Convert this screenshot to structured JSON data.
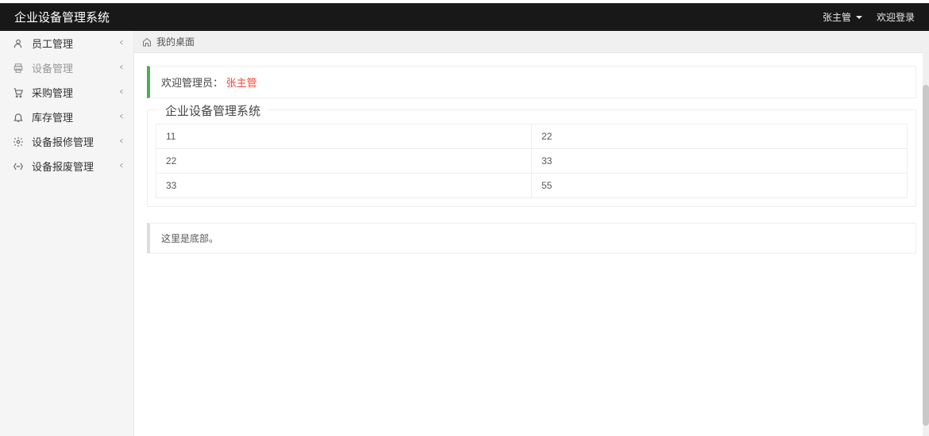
{
  "header": {
    "title": "企业设备管理系统",
    "user": "张主管",
    "login_text": "欢迎登录"
  },
  "sidebar": {
    "items": [
      {
        "icon": "user",
        "label": "员工管理"
      },
      {
        "icon": "printer",
        "label": "设备管理"
      },
      {
        "icon": "cart",
        "label": "采购管理"
      },
      {
        "icon": "bell",
        "label": "库存管理"
      },
      {
        "icon": "gear",
        "label": "设备报修管理"
      },
      {
        "icon": "recycle",
        "label": "设备报废管理"
      }
    ]
  },
  "breadcrumb": {
    "label": "我的桌面"
  },
  "welcome": {
    "prefix": "欢迎管理员：",
    "name": "张主管"
  },
  "fieldset": {
    "title": "企业设备管理系统"
  },
  "table": {
    "rows": [
      [
        "11",
        "22"
      ],
      [
        "22",
        "33"
      ],
      [
        "33",
        "55"
      ]
    ]
  },
  "footer": {
    "text": "这里是底部。"
  }
}
